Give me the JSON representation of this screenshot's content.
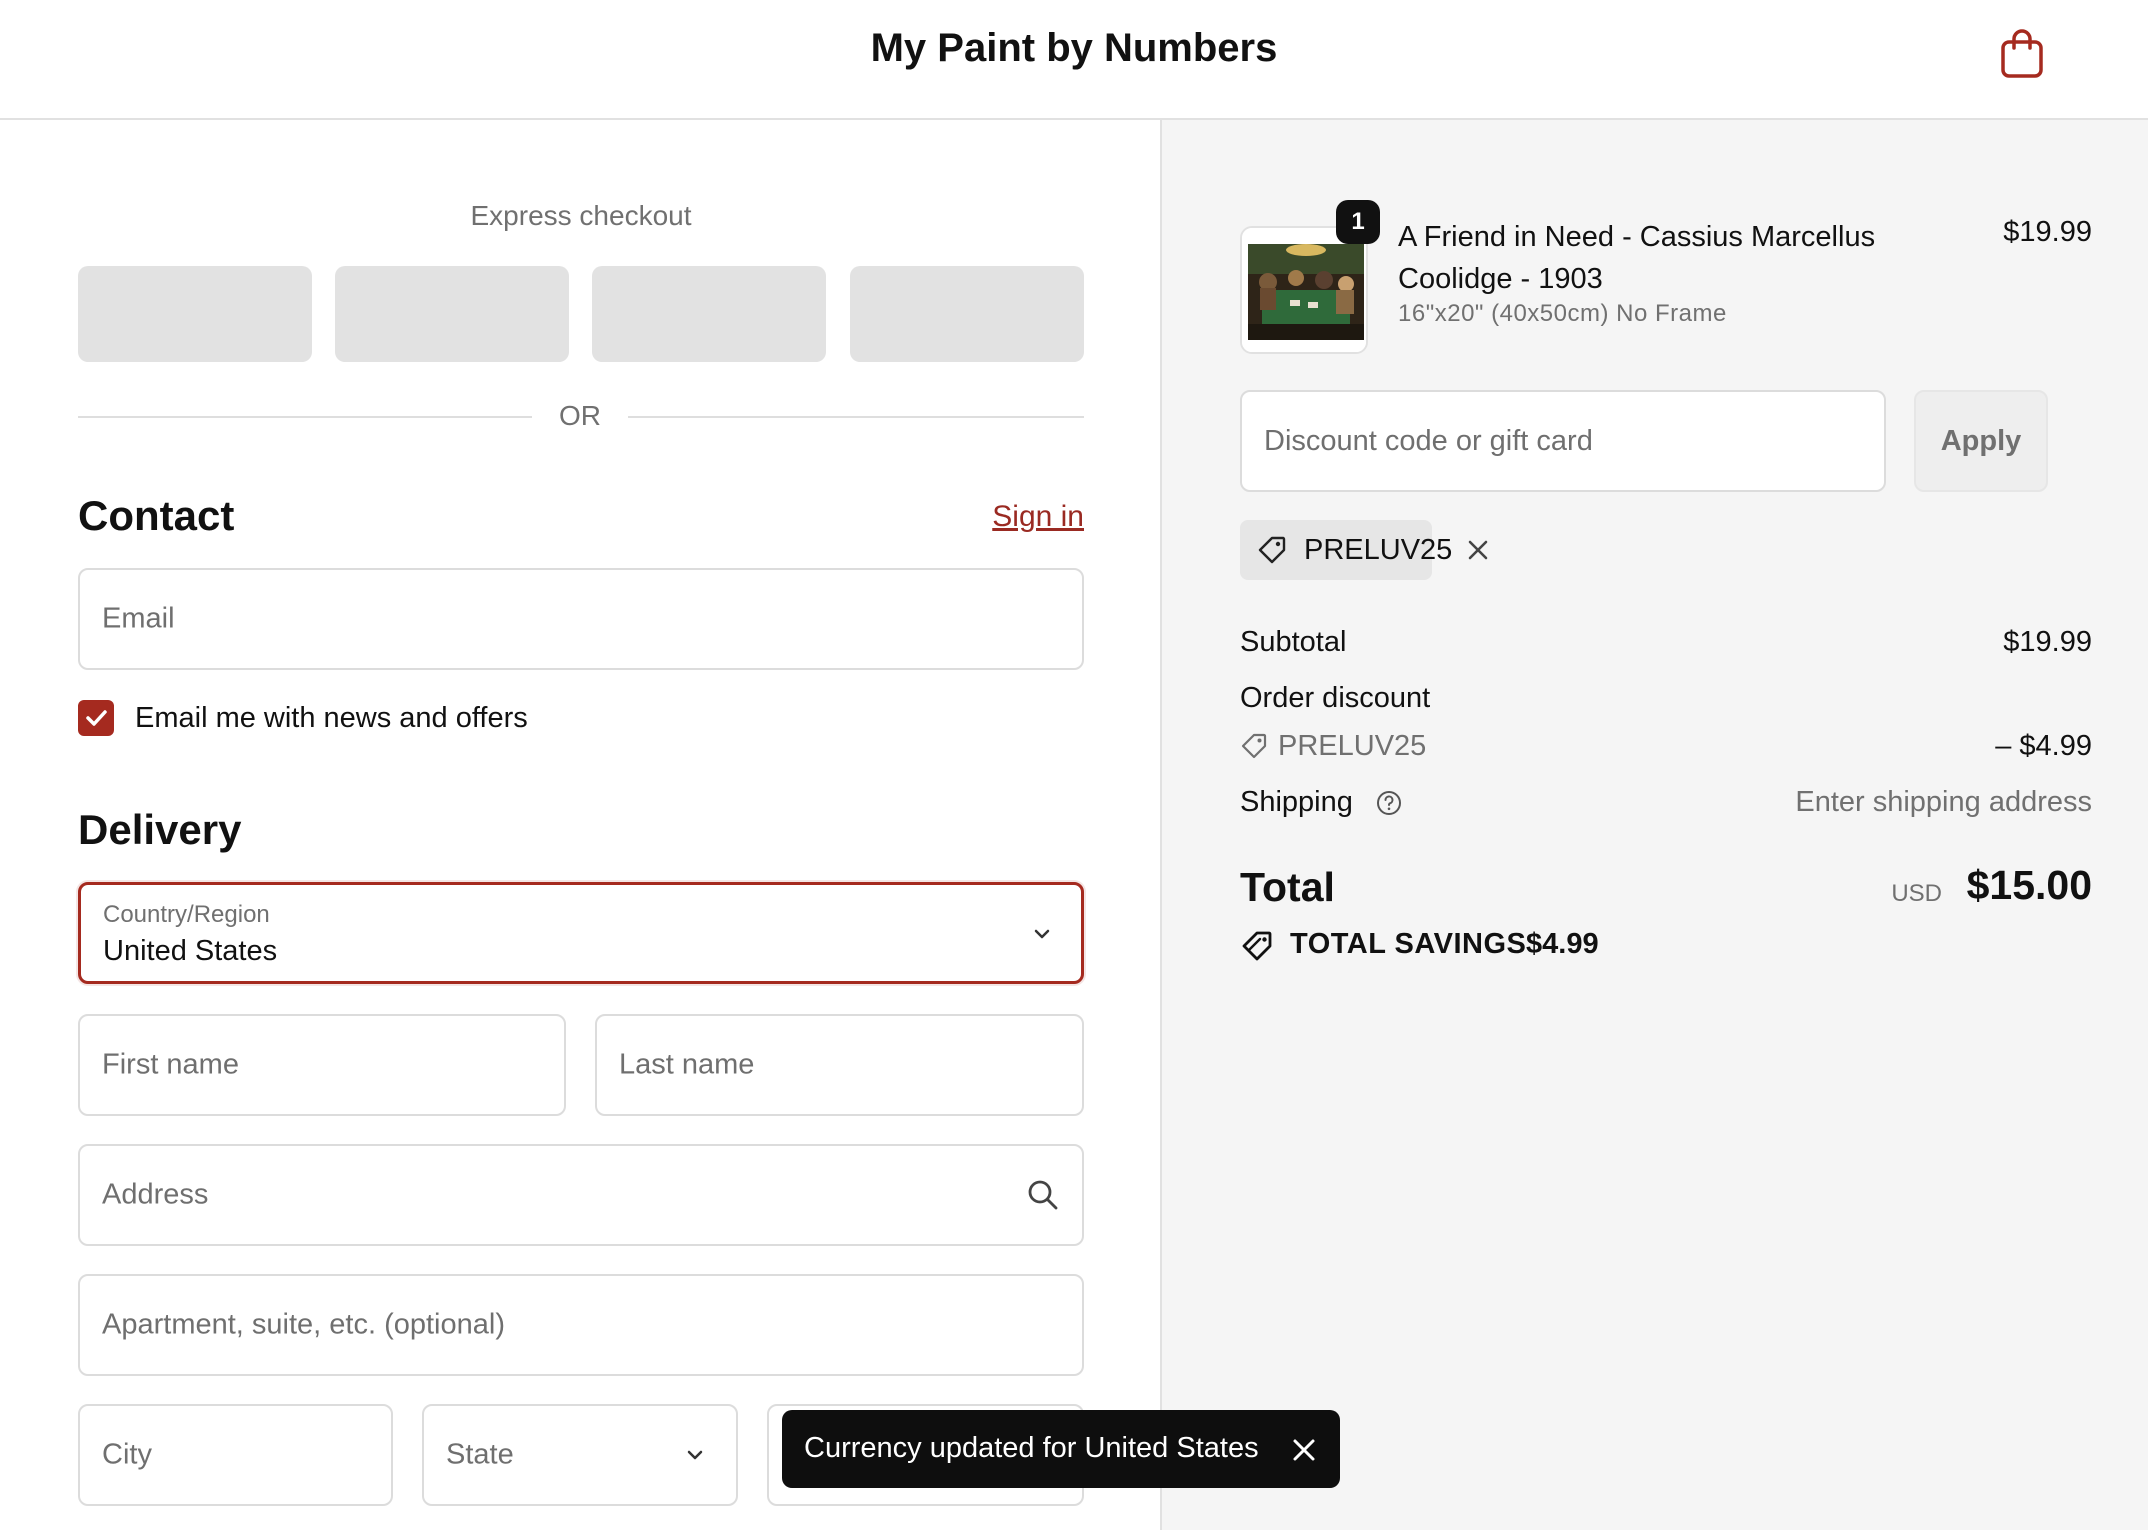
{
  "store": {
    "title": "My Paint by Numbers"
  },
  "colors": {
    "accent": "#a52a1f",
    "toast_bg": "#0e0e0e",
    "summary_bg": "#f5f5f5"
  },
  "express": {
    "label": "Express checkout",
    "or": "OR"
  },
  "contact": {
    "title": "Contact",
    "sign_in": "Sign in",
    "email_placeholder": "Email",
    "newsletter_label": "Email me with news and offers",
    "newsletter_checked": true
  },
  "delivery": {
    "title": "Delivery",
    "country_label": "Country/Region",
    "country_value": "United States",
    "first_name_placeholder": "First name",
    "last_name_placeholder": "Last name",
    "address_placeholder": "Address",
    "apartment_placeholder": "Apartment, suite, etc. (optional)",
    "city_placeholder": "City",
    "state_placeholder": "State"
  },
  "toast": {
    "message": "Currency updated for United States"
  },
  "cart": {
    "item": {
      "quantity": "1",
      "name": "A Friend in Need - Cassius Marcellus Coolidge - 1903",
      "variant": "16\"x20\" (40x50cm) No Frame",
      "price": "$19.99"
    },
    "discount_placeholder": "Discount code or gift card",
    "apply_label": "Apply",
    "applied_code": "PRELUV25"
  },
  "summary": {
    "subtotal_label": "Subtotal",
    "subtotal_value": "$19.99",
    "order_discount_label": "Order discount",
    "discount_code": "PRELUV25",
    "discount_value": "– $4.99",
    "shipping_label": "Shipping",
    "shipping_value": "Enter shipping address",
    "total_label": "Total",
    "currency": "USD",
    "total_value": "$15.00",
    "savings_label": "TOTAL SAVINGS",
    "savings_value": "$4.99"
  }
}
